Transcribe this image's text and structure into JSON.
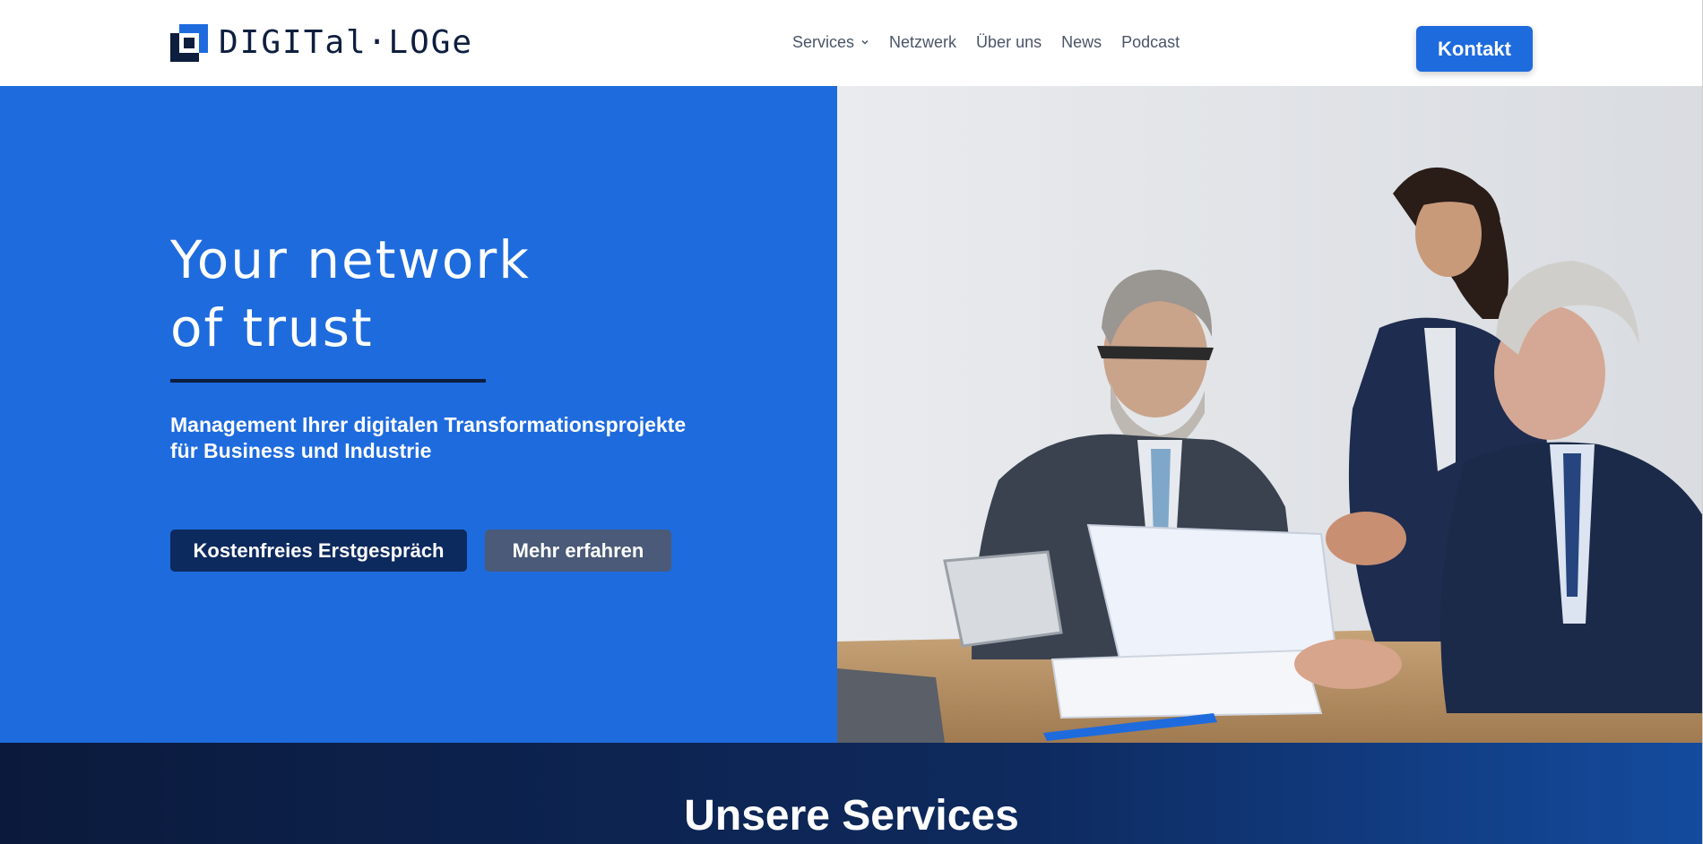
{
  "header": {
    "logo_text": "DIGITal·LOGe",
    "nav": [
      {
        "label": "Services",
        "has_dropdown": true
      },
      {
        "label": "Netzwerk"
      },
      {
        "label": "Über uns"
      },
      {
        "label": "News"
      },
      {
        "label": "Podcast"
      }
    ],
    "cta_label": "Kontakt"
  },
  "hero": {
    "title_line1": "Your network",
    "title_line2": "of trust",
    "subtitle_line1": "Management Ihrer digitalen Transformationsprojekte",
    "subtitle_line2": "für Business und Industrie",
    "primary_button": "Kostenfreies Erstgespräch",
    "secondary_button": "Mehr erfahren"
  },
  "services": {
    "title": "Unsere Services"
  },
  "colors": {
    "brand_blue": "#1e6bde",
    "navy": "#0d1e3f",
    "dark_button": "#0d2a5e",
    "gray_button": "#4a5a78"
  }
}
